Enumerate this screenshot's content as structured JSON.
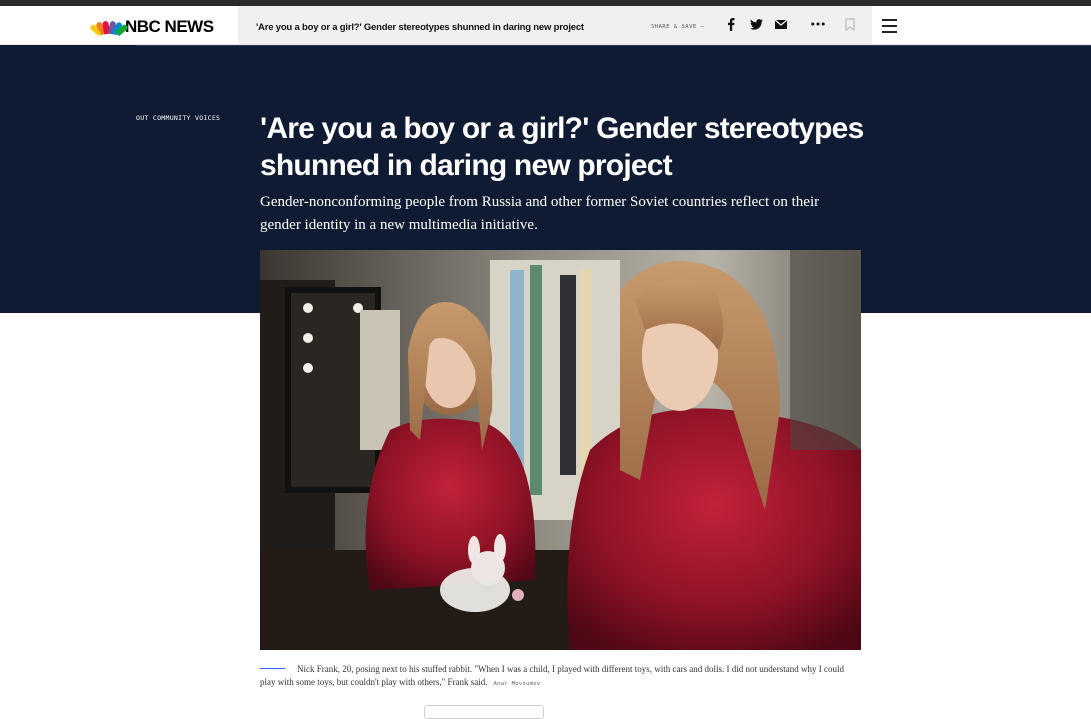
{
  "site": {
    "logo_text": "NBC NEWS"
  },
  "header": {
    "headline": "'Are you a boy or a girl?' Gender stereotypes shunned in daring new project",
    "share_label": "SHARE & SAVE —",
    "icons": [
      "facebook-icon",
      "twitter-icon",
      "email-icon",
      "more-icon",
      "bookmark-icon",
      "menu-icon"
    ]
  },
  "article": {
    "section": "OUT COMMUNITY VOICES",
    "title": "'Are you a boy or a girl?' Gender stereotypes shunned in daring new project",
    "dek": "Gender-nonconforming people from Russia and other former Soviet countries reflect on their gender identity in a new multimedia initiative.",
    "caption": "Nick Frank, 20, posing next to his stuffed rabbit. \"When I was a child, I played with different toys, with cars and dolls. I did not understand why I could play with some toys, but couldn't play with others,\" Frank said.",
    "credit": "Anar Movsumov"
  },
  "colors": {
    "hero_bg": "#0f1b33",
    "accent_rule": "#3061ff",
    "headline_bar_bg": "#f0f0f0"
  }
}
